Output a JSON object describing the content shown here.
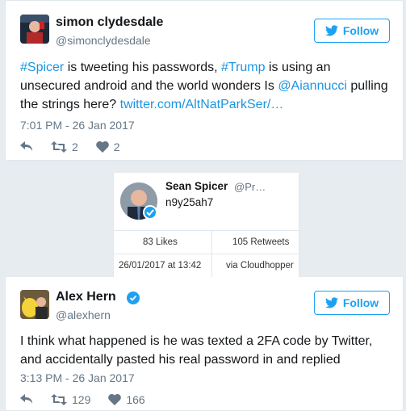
{
  "tweet1": {
    "name": "simon clydesdale",
    "handle": "@simonclydesdale",
    "follow_label": "Follow",
    "text_parts": [
      "#Spicer",
      " is tweeting his passwords, ",
      "#Trump",
      " is using an",
      "unsecured android and the world wonders Is ",
      "@Aiannucci",
      " pulling",
      "the strings here? ",
      "twitter.com/AltNatParkSer/…"
    ],
    "time": "7:01 PM - 26 Jan 2017",
    "retweets": "2",
    "likes": "2"
  },
  "embed": {
    "name": "Sean Spicer",
    "handle": "@Pr…",
    "text": "n9y25ah7",
    "likes": "83 Likes",
    "retweets": "105 Retweets",
    "date": "26/01/2017 at 13:42",
    "via": "via Cloudhopper"
  },
  "tweet2": {
    "name": "Alex Hern",
    "handle": "@alexhern",
    "follow_label": "Follow",
    "text_line1": "I think what happened is he was texted a 2FA code by Twitter,",
    "text_line2": "and accidentally pasted his real password in and replied",
    "time": "3:13 PM - 26 Jan 2017",
    "retweets": "129",
    "likes": "166"
  },
  "colors": {
    "link": "#1b95e0",
    "follow": "#1da1f2",
    "muted": "#657786"
  }
}
